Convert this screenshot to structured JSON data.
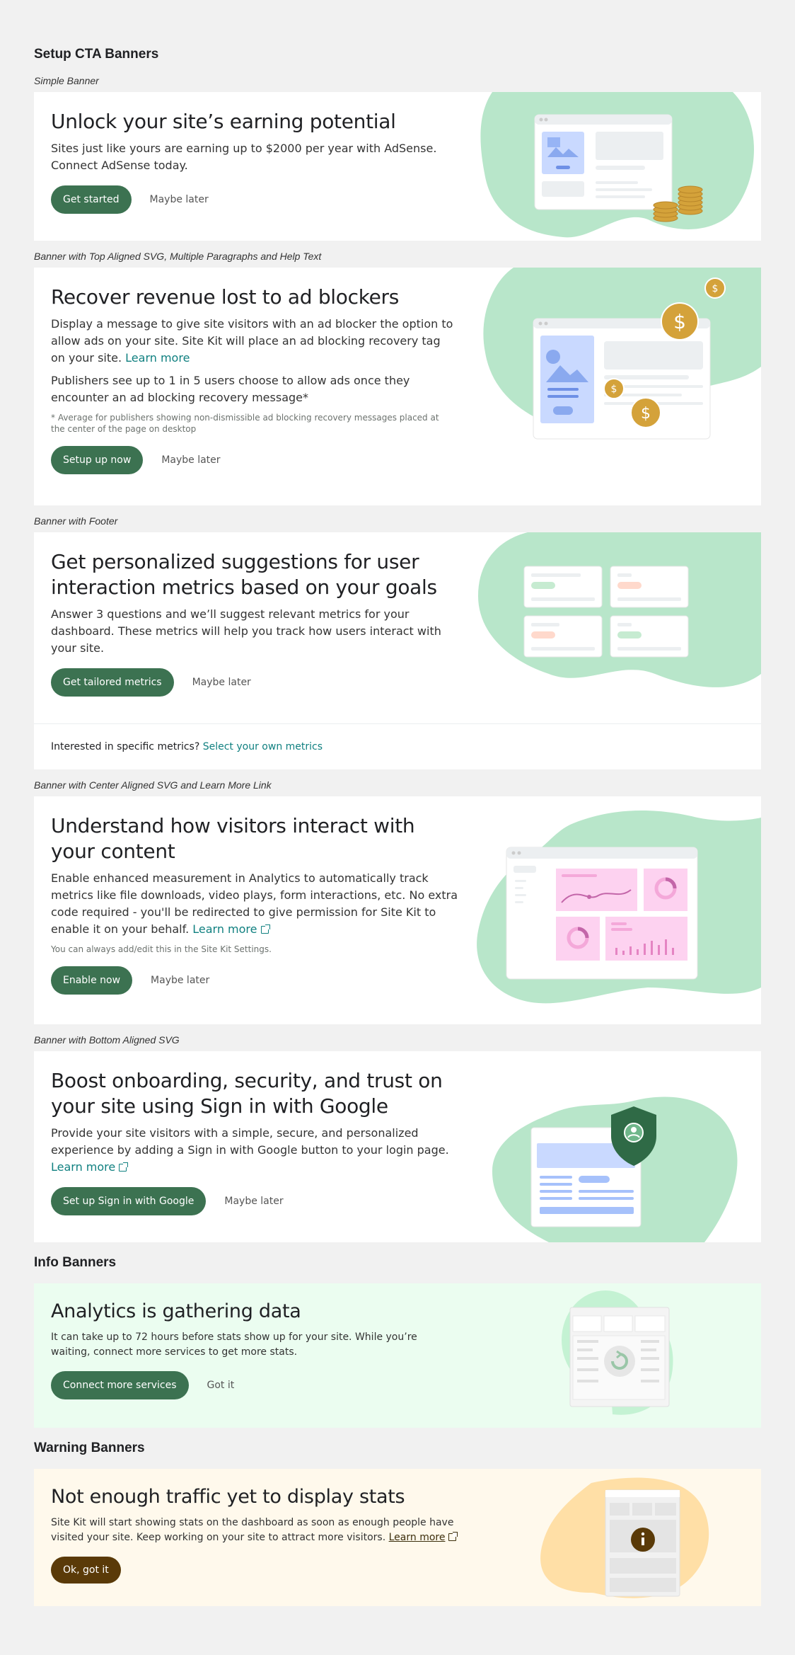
{
  "sections": {
    "setup": "Setup CTA Banners",
    "info": "Info Banners",
    "warning": "Warning Banners"
  },
  "b1": {
    "label": "Simple Banner",
    "title": "Unlock your site’s earning potential",
    "desc": "Sites just like yours are earning up to $2000 per year with AdSense. Connect AdSense today.",
    "cta": "Get started",
    "dismiss": "Maybe later"
  },
  "b2": {
    "label": "Banner with Top Aligned SVG, Multiple Paragraphs and Help Text",
    "title": "Recover revenue lost to ad blockers",
    "desc1": "Display a message to give site visitors with an ad blocker the option to allow ads on your site. Site Kit will place an ad blocking recovery tag on your site.",
    "learn_more": "Learn more",
    "desc2": "Publishers see up to 1 in 5 users choose to allow ads once they encounter an ad blocking recovery message*",
    "help": "* Average for publishers showing non-dismissible ad blocking recovery messages placed at the center of the page on desktop",
    "cta": "Setup up now",
    "dismiss": "Maybe later"
  },
  "b3": {
    "label": "Banner with Footer",
    "title": "Get personalized suggestions for user interaction metrics based on your goals",
    "desc": "Answer 3 questions and we’ll suggest relevant metrics for your dashboard. These metrics will help you track how users interact with your site.",
    "cta": "Get tailored metrics",
    "dismiss": "Maybe later",
    "footer_text": "Interested in specific metrics?",
    "footer_link": "Select your own metrics"
  },
  "b4": {
    "label": "Banner with Center Aligned SVG and Learn More Link",
    "title": "Understand how visitors interact with your content",
    "desc": "Enable enhanced measurement in Analytics to automatically track metrics like file downloads, video plays, form interactions, etc. No extra code required - you'll be redirected to give permission for Site Kit to enable it on your behalf.",
    "learn_more": "Learn more",
    "help": "You can always add/edit this in the Site Kit Settings.",
    "cta": "Enable now",
    "dismiss": "Maybe later"
  },
  "b5": {
    "label": "Banner with Bottom Aligned SVG",
    "title": "Boost onboarding, security, and trust on your site using Sign in with Google",
    "desc": "Provide your site visitors with a simple, secure, and personalized experience by adding a Sign in with Google button to your login page.",
    "learn_more": "Learn more",
    "cta": "Set up Sign in with Google",
    "dismiss": "Maybe later"
  },
  "b6": {
    "title": "Analytics is gathering data",
    "desc": "It can take up to 72 hours before stats show up for your site. While you’re waiting, connect more services to get more stats.",
    "cta": "Connect more services",
    "dismiss": "Got it"
  },
  "b7": {
    "title": "Not enough traffic yet to display stats",
    "desc": "Site Kit will start showing stats on the dashboard as soon as enough people have visited your site. Keep working on your site to attract more visitors.",
    "learn_more": "Learn more",
    "cta": "Ok, got it"
  },
  "colors": {
    "primary": "#3c7251",
    "link": "#108080",
    "blob_green": "#b8e6ca",
    "info_bg": "#ebfdf0",
    "warn_bg": "#fff9ec",
    "warn_button": "#5a3a08",
    "coin": "#d4a23a"
  }
}
